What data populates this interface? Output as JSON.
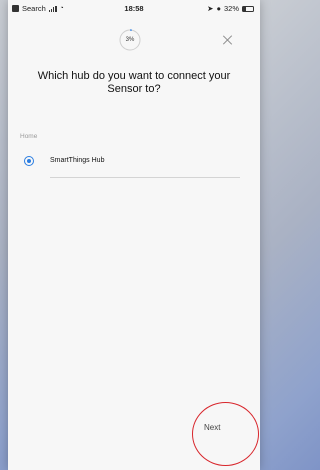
{
  "status_bar": {
    "back_label": "Search",
    "time": "18:58",
    "battery": "32%",
    "battery_level": 0.32
  },
  "progress": {
    "label": "3%",
    "value": 0.03
  },
  "title": "Which hub do you want to connect your Sensor to?",
  "section_label": "Home",
  "hubs": [
    {
      "label": "SmartThings Hub",
      "selected": true
    }
  ],
  "next_label": "Next",
  "icons": {
    "close": "close-icon",
    "radio": "radio-selected-icon",
    "signal": "signal-icon",
    "wifi": "wifi-icon",
    "location": "location-arrow-icon",
    "alarm": "alarm-icon",
    "battery": "battery-icon"
  },
  "colors": {
    "accent": "#2a7de1",
    "highlight": "#d8262c"
  }
}
